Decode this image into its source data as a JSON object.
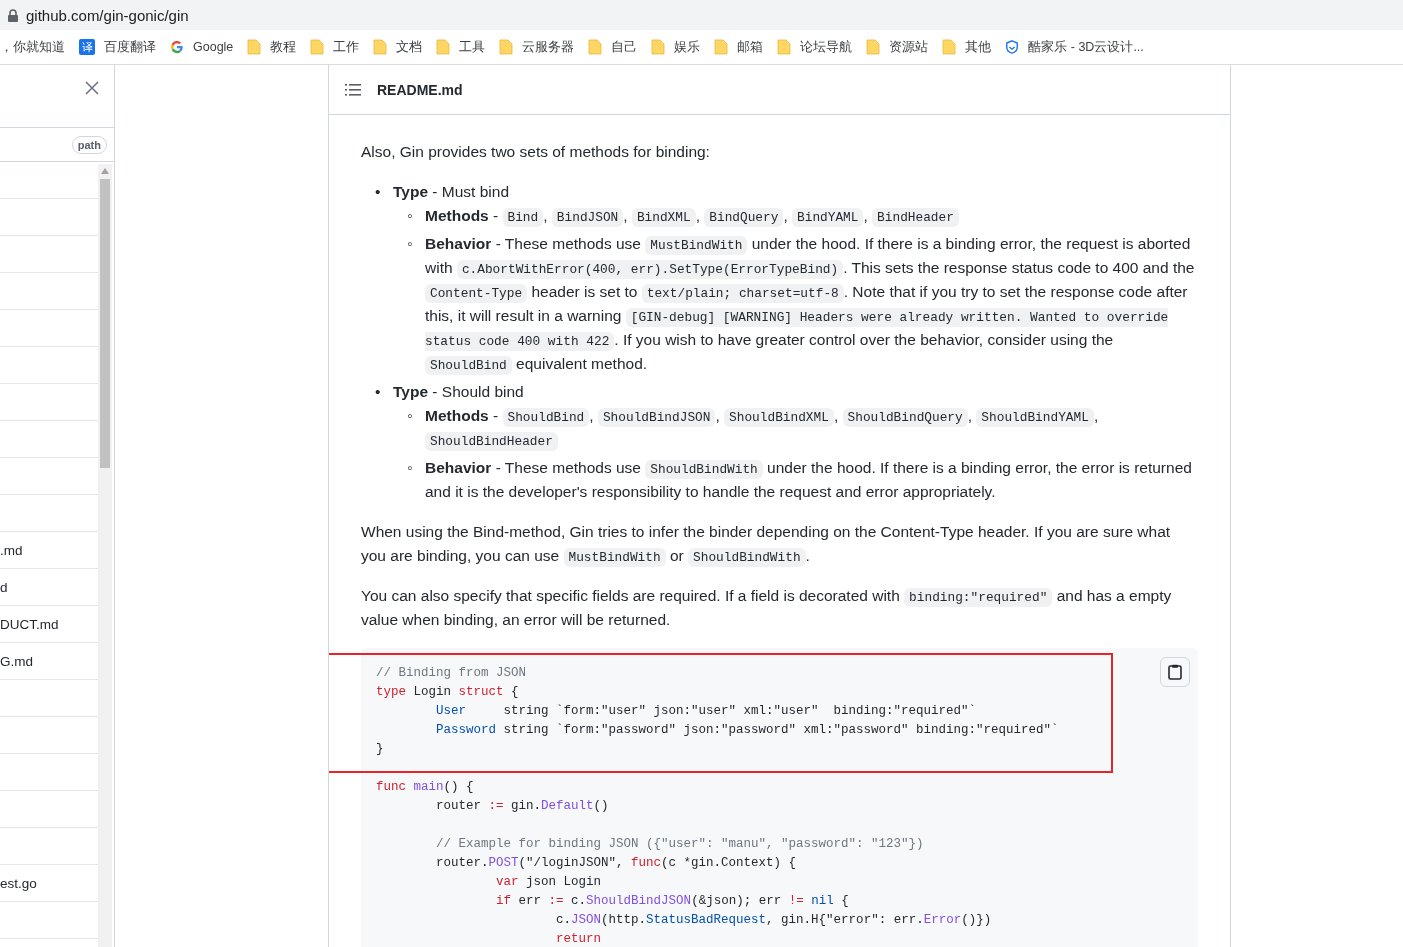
{
  "browser": {
    "url": "github.com/gin-gonic/gin",
    "bookmarks": [
      {
        "kind": "none",
        "label": "，你就知道"
      },
      {
        "kind": "badge",
        "badge": "译",
        "label": "百度翻译"
      },
      {
        "kind": "google",
        "label": "Google"
      },
      {
        "kind": "folder",
        "label": "教程"
      },
      {
        "kind": "folder",
        "label": "工作"
      },
      {
        "kind": "folder",
        "label": "文档"
      },
      {
        "kind": "folder",
        "label": "工具"
      },
      {
        "kind": "folder",
        "label": "云服务器"
      },
      {
        "kind": "folder",
        "label": "自己"
      },
      {
        "kind": "folder",
        "label": "娱乐"
      },
      {
        "kind": "folder",
        "label": "邮箱"
      },
      {
        "kind": "folder",
        "label": "论坛导航"
      },
      {
        "kind": "folder",
        "label": "资源站"
      },
      {
        "kind": "folder",
        "label": "其他"
      },
      {
        "kind": "shield",
        "label": "酷家乐 - 3D云设计..."
      }
    ]
  },
  "file_panel": {
    "path_button": "path",
    "files": [
      {
        "kind": "blank"
      },
      {
        "kind": "blank"
      },
      {
        "kind": "blank"
      },
      {
        "kind": "blank"
      },
      {
        "kind": "blank"
      },
      {
        "kind": "blank"
      },
      {
        "kind": "blank"
      },
      {
        "kind": "blank"
      },
      {
        "kind": "blank"
      },
      {
        "kind": "blank"
      },
      {
        "kind": "file",
        "name": ".md"
      },
      {
        "kind": "file",
        "name": "d"
      },
      {
        "kind": "file",
        "name": "DUCT.md"
      },
      {
        "kind": "file",
        "name": "G.md"
      },
      {
        "kind": "blank"
      },
      {
        "kind": "blank"
      },
      {
        "kind": "blank"
      },
      {
        "kind": "blank"
      },
      {
        "kind": "blank"
      },
      {
        "kind": "file",
        "name": "est.go"
      },
      {
        "kind": "blank"
      }
    ]
  },
  "readme": {
    "title": "README.md",
    "blocks": [
      {
        "kind": "paragraph",
        "parts": [
          {
            "kind": "text",
            "t": "Also, Gin provides two sets of methods for binding:"
          }
        ]
      },
      {
        "kind": "list",
        "items": [
          {
            "marker": "•",
            "parts": [
              {
                "kind": "text",
                "t": "**Type** - Must bind"
              }
            ],
            "children": [
              {
                "marker": "◦",
                "parts": [
                  {
                    "kind": "text",
                    "t": "**Methods** - "
                  },
                  {
                    "kind": "code",
                    "t": "Bind"
                  },
                  {
                    "kind": "text",
                    "t": ", "
                  },
                  {
                    "kind": "code",
                    "t": "BindJSON"
                  },
                  {
                    "kind": "text",
                    "t": ", "
                  },
                  {
                    "kind": "code",
                    "t": "BindXML"
                  },
                  {
                    "kind": "text",
                    "t": ", "
                  },
                  {
                    "kind": "code",
                    "t": "BindQuery"
                  },
                  {
                    "kind": "text",
                    "t": ", "
                  },
                  {
                    "kind": "code",
                    "t": "BindYAML"
                  },
                  {
                    "kind": "text",
                    "t": ", "
                  },
                  {
                    "kind": "code",
                    "t": "BindHeader"
                  }
                ]
              },
              {
                "marker": "◦",
                "parts": [
                  {
                    "kind": "text",
                    "t": "**Behavior** - These methods use "
                  },
                  {
                    "kind": "code",
                    "t": "MustBindWith"
                  },
                  {
                    "kind": "text",
                    "t": " under the hood. If there is a binding error, the request is aborted with "
                  },
                  {
                    "kind": "code",
                    "t": "c.AbortWithError(400, err).SetType(ErrorTypeBind)"
                  },
                  {
                    "kind": "text",
                    "t": ". This sets the response status code to 400 and the "
                  },
                  {
                    "kind": "code",
                    "t": "Content-Type"
                  },
                  {
                    "kind": "text",
                    "t": " header is set to "
                  },
                  {
                    "kind": "code",
                    "t": "text/plain; charset=utf-8"
                  },
                  {
                    "kind": "text",
                    "t": ". Note that if you try to set the response code after this, it will result in a warning "
                  },
                  {
                    "kind": "code",
                    "t": "[GIN-debug] [WARNING] Headers were already written. Wanted to override status code 400 with 422"
                  },
                  {
                    "kind": "text",
                    "t": ". If you wish to have greater control over the behavior, consider using the "
                  },
                  {
                    "kind": "code",
                    "t": "ShouldBind"
                  },
                  {
                    "kind": "text",
                    "t": " equivalent method."
                  }
                ]
              }
            ]
          },
          {
            "marker": "•",
            "parts": [
              {
                "kind": "text",
                "t": "**Type** - Should bind"
              }
            ],
            "children": [
              {
                "marker": "◦",
                "parts": [
                  {
                    "kind": "text",
                    "t": "**Methods** - "
                  },
                  {
                    "kind": "code",
                    "t": "ShouldBind"
                  },
                  {
                    "kind": "text",
                    "t": ", "
                  },
                  {
                    "kind": "code",
                    "t": "ShouldBindJSON"
                  },
                  {
                    "kind": "text",
                    "t": ", "
                  },
                  {
                    "kind": "code",
                    "t": "ShouldBindXML"
                  },
                  {
                    "kind": "text",
                    "t": ", "
                  },
                  {
                    "kind": "code",
                    "t": "ShouldBindQuery"
                  },
                  {
                    "kind": "text",
                    "t": ", "
                  },
                  {
                    "kind": "code",
                    "t": "ShouldBindYAML"
                  },
                  {
                    "kind": "text",
                    "t": ", "
                  },
                  {
                    "kind": "code",
                    "t": "ShouldBindHeader"
                  }
                ]
              },
              {
                "marker": "◦",
                "parts": [
                  {
                    "kind": "text",
                    "t": "**Behavior** - These methods use "
                  },
                  {
                    "kind": "code",
                    "t": "ShouldBindWith"
                  },
                  {
                    "kind": "text",
                    "t": " under the hood. If there is a binding error, the error is returned and it is the developer's responsibility to handle the request and error appropriately."
                  }
                ]
              }
            ]
          }
        ]
      },
      {
        "kind": "paragraph",
        "parts": [
          {
            "kind": "text",
            "t": "When using the Bind-method, Gin tries to infer the binder depending on the Content-Type header. If you are sure what you are binding, you can use "
          },
          {
            "kind": "code",
            "t": "MustBindWith"
          },
          {
            "kind": "text",
            "t": " or "
          },
          {
            "kind": "code",
            "t": "ShouldBindWith"
          },
          {
            "kind": "text",
            "t": "."
          }
        ]
      },
      {
        "kind": "paragraph",
        "parts": [
          {
            "kind": "text",
            "t": "You can also specify that specific fields are required. If a field is decorated with "
          },
          {
            "kind": "code",
            "t": "binding:\"required\""
          },
          {
            "kind": "text",
            "t": " and has a empty value when binding, an error will be returned."
          }
        ]
      }
    ],
    "code": {
      "lines": [
        {
          "kind": "code",
          "highlighted": true,
          "tokens": [
            {
              "kind": "comment",
              "t": "// Binding from JSON"
            }
          ]
        },
        {
          "kind": "code",
          "highlighted": true,
          "tokens": [
            {
              "kind": "kw",
              "t": "type"
            },
            {
              "kind": "plain",
              "t": " Login "
            },
            {
              "kind": "kw",
              "t": "struct"
            },
            {
              "kind": "plain",
              "t": " {"
            }
          ]
        },
        {
          "kind": "code",
          "highlighted": true,
          "tokens": [
            {
              "kind": "field",
              "t": "\tUser"
            },
            {
              "kind": "plain",
              "t": "     string `form:\"user\" json:\"user\" xml:\"user\"  binding:\"required\"`"
            }
          ]
        },
        {
          "kind": "code",
          "highlighted": true,
          "tokens": [
            {
              "kind": "field",
              "t": "\tPassword"
            },
            {
              "kind": "plain",
              "t": " string `form:\"password\" json:\"password\" xml:\"password\" binding:\"required\"`"
            }
          ]
        },
        {
          "kind": "code",
          "highlighted": true,
          "tokens": [
            {
              "kind": "plain",
              "t": "}"
            }
          ]
        },
        {
          "kind": "code",
          "highlighted": false,
          "tokens": [
            {
              "kind": "kw",
              "t": "func "
            },
            {
              "kind": "fn",
              "t": "main"
            },
            {
              "kind": "plain",
              "t": "() {"
            }
          ]
        },
        {
          "kind": "code",
          "highlighted": false,
          "tokens": [
            {
              "kind": "plain",
              "t": "\trouter "
            },
            {
              "kind": "kw",
              "t": ":="
            },
            {
              "kind": "plain",
              "t": " gin."
            },
            {
              "kind": "fn",
              "t": "Default"
            },
            {
              "kind": "plain",
              "t": "()"
            }
          ]
        },
        {
          "kind": "blank",
          "highlighted": false
        },
        {
          "kind": "code",
          "highlighted": false,
          "tokens": [
            {
              "kind": "comment",
              "t": "\t// Example for binding JSON ({\"user\": \"manu\", \"password\": \"123\"})"
            }
          ]
        },
        {
          "kind": "code",
          "highlighted": false,
          "tokens": [
            {
              "kind": "plain",
              "t": "\trouter."
            },
            {
              "kind": "fn",
              "t": "POST"
            },
            {
              "kind": "plain",
              "t": "(\"/loginJSON\", "
            },
            {
              "kind": "kw",
              "t": "func"
            },
            {
              "kind": "plain",
              "t": "(c *gin.Context) {"
            }
          ]
        },
        {
          "kind": "code",
          "highlighted": false,
          "tokens": [
            {
              "kind": "kw",
              "t": "\t\tvar"
            },
            {
              "kind": "plain",
              "t": " json Login"
            }
          ]
        },
        {
          "kind": "code",
          "highlighted": false,
          "tokens": [
            {
              "kind": "kw",
              "t": "\t\tif"
            },
            {
              "kind": "plain",
              "t": " err "
            },
            {
              "kind": "kw",
              "t": ":="
            },
            {
              "kind": "plain",
              "t": " c."
            },
            {
              "kind": "fn",
              "t": "ShouldBindJSON"
            },
            {
              "kind": "plain",
              "t": "(&json); err "
            },
            {
              "kind": "kw",
              "t": "!= "
            },
            {
              "kind": "field",
              "t": "nil"
            },
            {
              "kind": "plain",
              "t": " {"
            }
          ]
        },
        {
          "kind": "code",
          "highlighted": false,
          "tokens": [
            {
              "kind": "plain",
              "t": "\t\t\tc."
            },
            {
              "kind": "fn",
              "t": "JSON"
            },
            {
              "kind": "plain",
              "t": "(http."
            },
            {
              "kind": "field",
              "t": "StatusBadRequest"
            },
            {
              "kind": "plain",
              "t": ", gin.H{\"error\": err."
            },
            {
              "kind": "fn",
              "t": "Error"
            },
            {
              "kind": "plain",
              "t": "()})"
            }
          ]
        },
        {
          "kind": "code",
          "highlighted": false,
          "tokens": [
            {
              "kind": "kw",
              "t": "\t\t\treturn"
            }
          ]
        }
      ]
    }
  }
}
